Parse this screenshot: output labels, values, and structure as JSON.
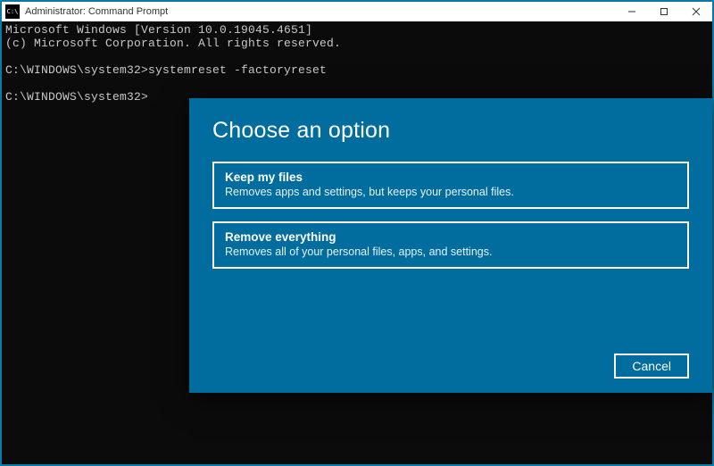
{
  "window": {
    "title": "Administrator: Command Prompt",
    "controls": {
      "minimize": "—",
      "maximize": "□",
      "close": "✕"
    }
  },
  "terminal": {
    "line1": "Microsoft Windows [Version 10.0.19045.4651]",
    "line2": "(c) Microsoft Corporation. All rights reserved.",
    "blank1": "",
    "prompt1": "C:\\WINDOWS\\system32>systemreset -factoryreset",
    "blank2": "",
    "prompt2": "C:\\WINDOWS\\system32>"
  },
  "dialog": {
    "heading": "Choose an option",
    "options": [
      {
        "title": "Keep my files",
        "desc": "Removes apps and settings, but keeps your personal files."
      },
      {
        "title": "Remove everything",
        "desc": "Removes all of your personal files, apps, and settings."
      }
    ],
    "cancel": "Cancel"
  }
}
